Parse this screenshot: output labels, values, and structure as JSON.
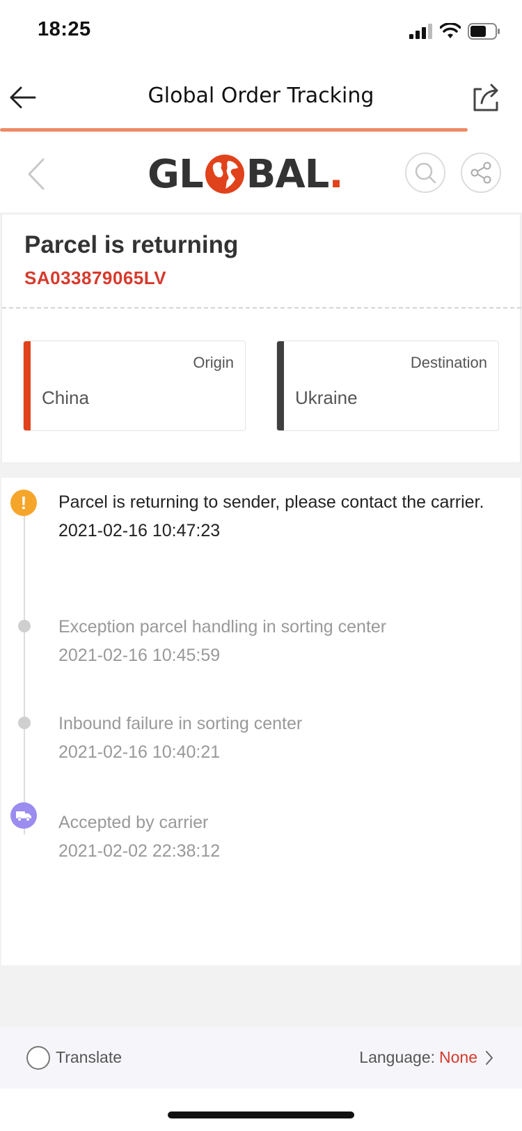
{
  "status_bar": {
    "time": "18:25"
  },
  "nav": {
    "title": "Global Order Tracking"
  },
  "logo": {
    "text_left": "GL",
    "text_right": "BAL",
    "text_dot": "."
  },
  "summary": {
    "status": "Parcel is returning",
    "tracking_number": "SA033879065LV",
    "origin": {
      "label": "Origin",
      "value": "China"
    },
    "destination": {
      "label": "Destination",
      "value": "Ukraine"
    }
  },
  "timeline": [
    {
      "text": "Parcel is returning to sender, please contact the carrier.",
      "time": "2021-02-16 10:47:23",
      "state": "active",
      "icon": "warning-icon"
    },
    {
      "text": "Exception parcel handling in sorting center",
      "time": "2021-02-16 10:45:59",
      "state": "past",
      "icon": "dot"
    },
    {
      "text": "Inbound failure in sorting center",
      "time": "2021-02-16 10:40:21",
      "state": "past",
      "icon": "dot"
    },
    {
      "text": "Accepted by carrier",
      "time": "2021-02-02 22:38:12",
      "state": "past",
      "icon": "truck-icon"
    }
  ],
  "bottom_bar": {
    "translate_label": "Translate",
    "language_label": "Language:",
    "language_value": "None"
  },
  "colors": {
    "accent_red": "#d63a2c",
    "logo_red": "#e0421b",
    "progress": "#ee8a66",
    "warning": "#f6a52b",
    "truck": "#9b8cf0"
  }
}
